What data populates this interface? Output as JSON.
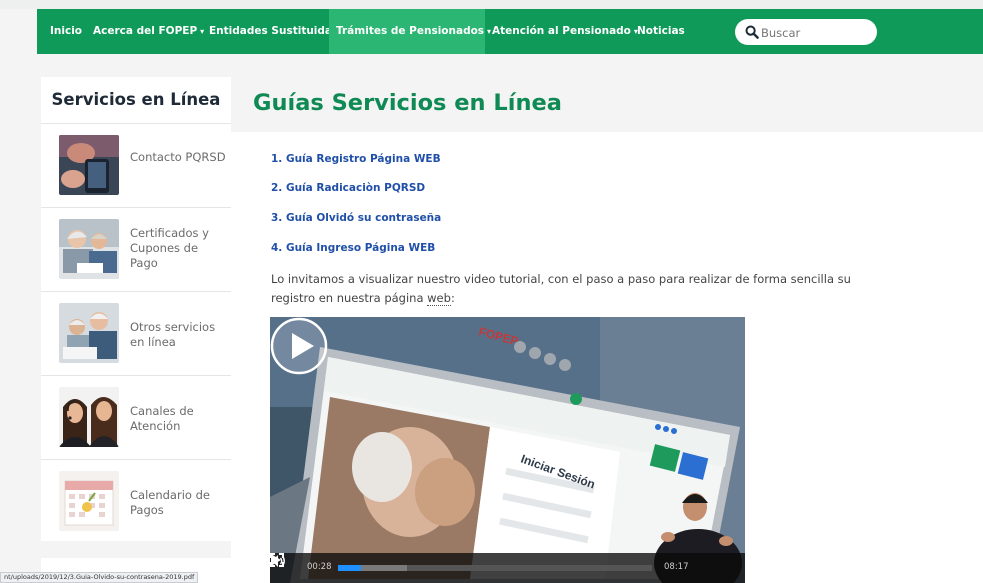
{
  "nav": {
    "items": [
      {
        "label": "Inicio",
        "caret": false
      },
      {
        "label": "Acerca del FOPEP",
        "caret": true
      },
      {
        "label": "Entidades Sustituidas",
        "caret": false
      },
      {
        "label": "Trámites de Pensionados",
        "caret": true,
        "active": true
      },
      {
        "label": "Atención al Pensionado",
        "caret": true
      },
      {
        "label": "Noticias",
        "caret": false
      }
    ],
    "search_placeholder": "Buscar",
    "caret_glyph": "▾"
  },
  "sidebar": {
    "title": "Servicios en Línea",
    "items": [
      {
        "label": "Contacto PQRSD"
      },
      {
        "label": "Certificados y Cupones de Pago"
      },
      {
        "label": "Otros servicios en línea"
      },
      {
        "label": "Canales de Atención"
      },
      {
        "label": "Calendario de Pagos"
      }
    ]
  },
  "main": {
    "title": "Guías Servicios en Línea",
    "guides": [
      {
        "label": "1.  Guía Registro Página WEB"
      },
      {
        "label": "2. Guía Radicaciòn PQRSD"
      },
      {
        "label": "3. Guía Olvidó su contraseña"
      },
      {
        "label": "4. Guía Ingreso Página WEB"
      }
    ],
    "intro_text": "Lo invitamos a visualizar nuestro video tutorial, con el paso a paso para realizar de forma sencilla su registro en nuestra página ",
    "intro_link": "web",
    "intro_end": ":"
  },
  "video": {
    "screen_logo": "FOPEP",
    "screen_heading": "Iniciar Sesión",
    "current_time": "00:28",
    "duration": "08:17",
    "progress": 0.074,
    "buffered": 0.22
  },
  "status_url": "nt/uploads/2019/12/3.Guia-Olvido-su-contrasena-2019.pdf",
  "colors": {
    "nav_green": "#0f9a5a",
    "nav_active": "#2bb673",
    "title_green": "#0f8a54",
    "link_blue": "#1f4fa8"
  }
}
